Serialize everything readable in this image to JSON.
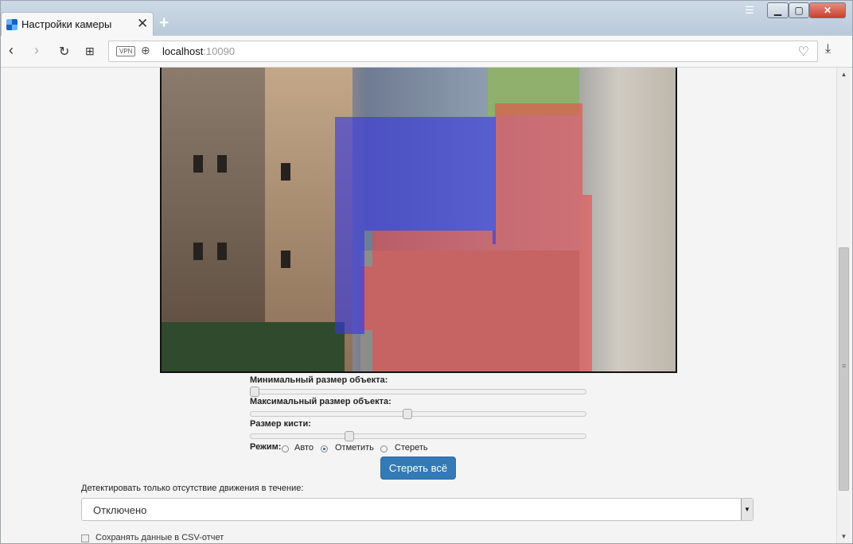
{
  "browser": {
    "tab_title": "Настройки камеры",
    "tab_close": "✕",
    "new_tab": "+",
    "url_host": "localhost",
    "url_port": ":10090",
    "vpn_badge": "VPN"
  },
  "controls": {
    "min_size_label": "Минимальный размер объекта:",
    "min_size_value": 0.0,
    "max_size_label": "Максимальный размер объекта:",
    "max_size_value": 0.47,
    "brush_label": "Размер кисти:",
    "brush_value": 0.29,
    "mode_label": "Режим:",
    "modes": [
      {
        "label": "Авто",
        "selected": false
      },
      {
        "label": "Отметить",
        "selected": true
      },
      {
        "label": "Стереть",
        "selected": false
      }
    ],
    "clear_all_button": "Стереть всё"
  },
  "detect": {
    "label": "Детектировать только отсутствие движения в течение:",
    "selected": "Отключено"
  },
  "csv": {
    "label": "Сохранять данные в CSV-отчет"
  },
  "colors": {
    "primary_button": "#337ab7",
    "mask_red": "rgba(238,70,70,0.58)",
    "mask_blue": "rgba(55,55,225,0.62)"
  }
}
